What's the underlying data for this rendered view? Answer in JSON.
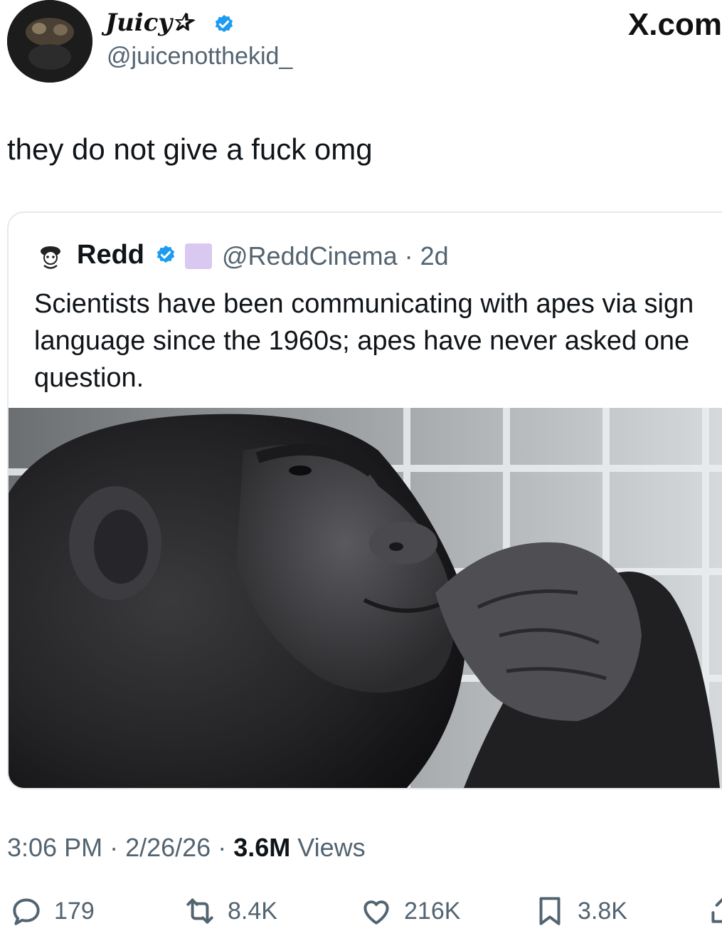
{
  "author": {
    "name": "Juicy✰",
    "handle": "@juicenotthekid_"
  },
  "brand": "X.com",
  "tweet_text": "they do not give a fuck omg",
  "quote": {
    "name": "Redd",
    "handle": "@ReddCinema",
    "age": "2d",
    "text": "Scientists  have been communicating with apes via sign language since the 1960s; apes have never asked one question."
  },
  "meta": {
    "time": "3:06 PM",
    "date": "2/26/26",
    "views_count": "3.6M",
    "views_label": "Views"
  },
  "actions": {
    "replies": "179",
    "reposts": "8.4K",
    "likes": "216K",
    "bookmarks": "3.8K"
  },
  "colors": {
    "verified": "#1d9bf0",
    "muted_text": "#536471",
    "text": "#0f1419",
    "border": "#e7e9ec"
  }
}
